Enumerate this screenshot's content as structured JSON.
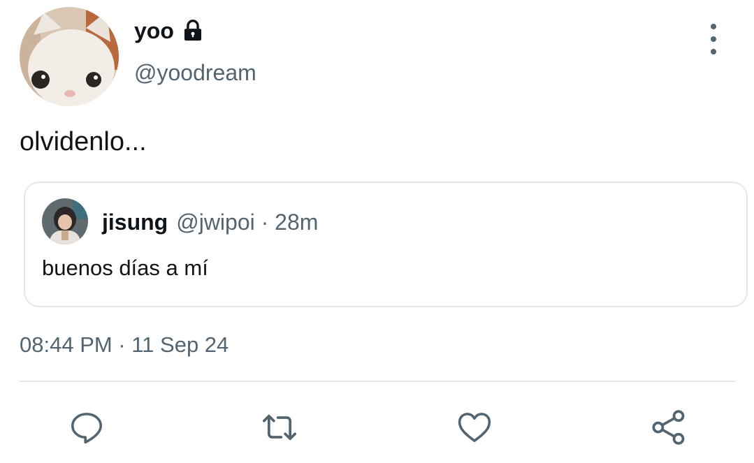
{
  "author": {
    "display_name": "yoo",
    "handle": "@yoodream",
    "avatar": "white-kitten-figurine-avatar",
    "locked_icon": "lock-icon"
  },
  "menu_icon": "more-vertical-icon",
  "tweet": {
    "text": "olvidenlo..."
  },
  "quoted_tweet": {
    "display_name": "jisung",
    "handle": "@jwipoi",
    "separator": "·",
    "time_ago": "28m",
    "text": "buenos días a mí",
    "avatar": "person-photo-avatar"
  },
  "timestamp": "08:44 PM · 11 Sep 24",
  "actions": [
    {
      "icon": "reply-icon"
    },
    {
      "icon": "retweet-icon"
    },
    {
      "icon": "like-icon"
    },
    {
      "icon": "share-icon"
    }
  ],
  "colors": {
    "text_primary": "#0f1419",
    "text_secondary": "#536471",
    "border": "#e3e7ea"
  }
}
